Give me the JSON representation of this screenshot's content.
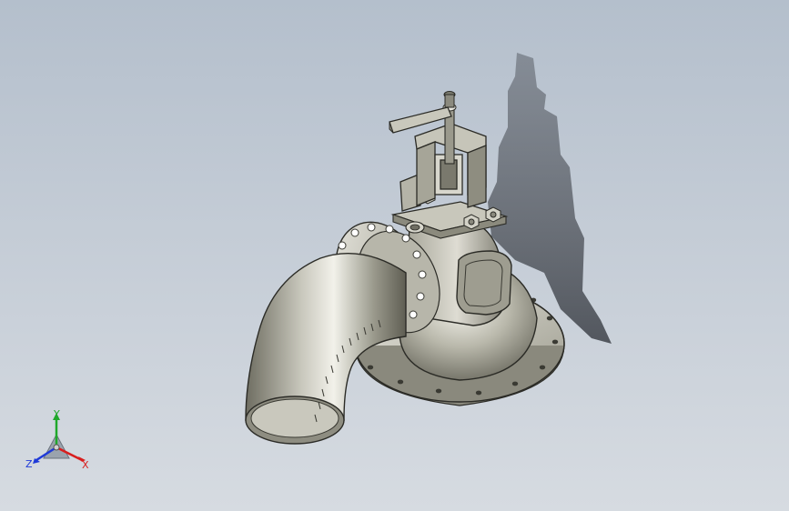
{
  "viewport": {
    "background_top": "#b4bfcc",
    "background_bottom": "#d6dbe1",
    "model_color": "#8f8e82"
  },
  "triad": {
    "x_label": "X",
    "y_label": "Y",
    "z_label": "Z",
    "x_color": "#d81e1e",
    "y_color": "#1fa82a",
    "z_color": "#1f3ad8"
  }
}
